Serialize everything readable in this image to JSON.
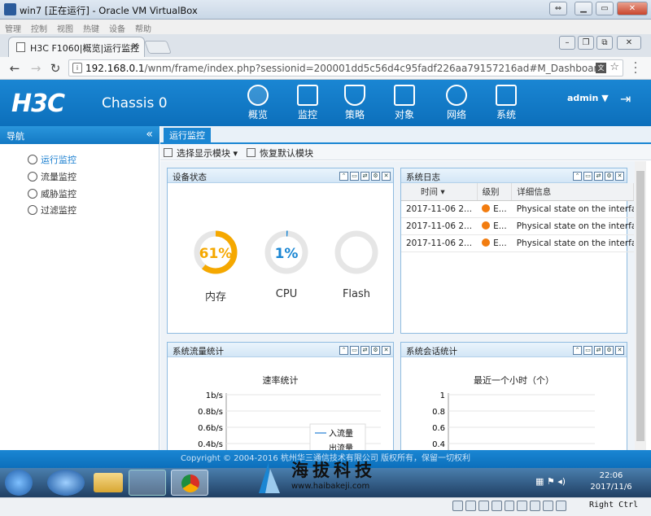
{
  "vbox": {
    "title": "win7 [正在运行] - Oracle VM VirtualBox",
    "menu": [
      "管理",
      "控制",
      "视图",
      "热键",
      "设备",
      "帮助"
    ],
    "host_key": "Right Ctrl"
  },
  "browser": {
    "tab_title": "H3C F1060|概览|运行监控",
    "url_host": "192.168.0.1",
    "url_path": "/wnm/frame/index.php?sessionid=200001dd5c56d4c95fadf226aa79157216ad#M_Dashboard"
  },
  "header": {
    "logo": "H3C",
    "device": "Chassis 0",
    "nav": [
      {
        "label": "概览",
        "icon": "dashboard-icon"
      },
      {
        "label": "监控",
        "icon": "monitor-icon"
      },
      {
        "label": "策略",
        "icon": "shield-icon"
      },
      {
        "label": "对象",
        "icon": "object-list-icon"
      },
      {
        "label": "网络",
        "icon": "internet-globe-icon"
      },
      {
        "label": "系统",
        "icon": "system-code-icon"
      }
    ],
    "user": "admin",
    "user_caret": "▼"
  },
  "sidebar": {
    "title": "导航",
    "collapse": "«",
    "items": [
      "运行监控",
      "流量监控",
      "威胁监控",
      "过滤监控"
    ]
  },
  "main": {
    "tab": "运行监控",
    "toolbar": {
      "select_modules": "选择显示模块",
      "restore_default": "恢复默认模块"
    }
  },
  "device_status": {
    "title": "设备状态",
    "gauges": [
      {
        "label": "内存",
        "value_text": "61%",
        "percent": 61,
        "color": "#f5a800"
      },
      {
        "label": "CPU",
        "value_text": "1%",
        "percent": 1,
        "color": "#1a86d3"
      },
      {
        "label": "Flash",
        "value_text": "",
        "percent": 0,
        "color": "#1a86d3"
      }
    ]
  },
  "system_log": {
    "title": "系统日志",
    "columns": [
      "时间",
      "级别",
      "详细信息"
    ],
    "rows": [
      {
        "time": "2017-11-06 2...",
        "level": "E...",
        "detail": "Physical state on the interface..."
      },
      {
        "time": "2017-11-06 2...",
        "level": "E...",
        "detail": "Physical state on the interface..."
      },
      {
        "time": "2017-11-06 2...",
        "level": "E...",
        "detail": "Physical state on the interface..."
      }
    ]
  },
  "traffic_stats": {
    "title": "系统流量统计",
    "chart_title": "速率统计",
    "y_ticks": [
      "1b/s",
      "0.8b/s",
      "0.6b/s",
      "0.4b/s"
    ],
    "legend": [
      "入流量",
      "出流量"
    ]
  },
  "session_stats": {
    "title": "系统会话统计",
    "chart_title": "最近一个小时（个）",
    "y_ticks": [
      "1",
      "0.8",
      "0.6",
      "0.4"
    ]
  },
  "chart_data": [
    {
      "type": "line",
      "title": "速率统计",
      "ylim": [
        0,
        1
      ],
      "y_ticks": [
        "1b/s",
        "0.8b/s",
        "0.6b/s",
        "0.4b/s"
      ],
      "series": [
        {
          "name": "入流量",
          "values": []
        },
        {
          "name": "出流量",
          "values": []
        }
      ]
    },
    {
      "type": "line",
      "title": "最近一个小时（个）",
      "ylim": [
        0,
        1
      ],
      "y_ticks": [
        "1",
        "0.8",
        "0.6",
        "0.4"
      ],
      "series": []
    }
  ],
  "footer": {
    "copyright": "Copyright © 2004-2016 杭州华三通信技术有限公司 版权所有，保留一切权利"
  },
  "watermark": {
    "name": "海拔科技",
    "url": "www.haibakeji.com"
  },
  "taskbar": {
    "time": "22:06",
    "date": "2017/11/6"
  }
}
